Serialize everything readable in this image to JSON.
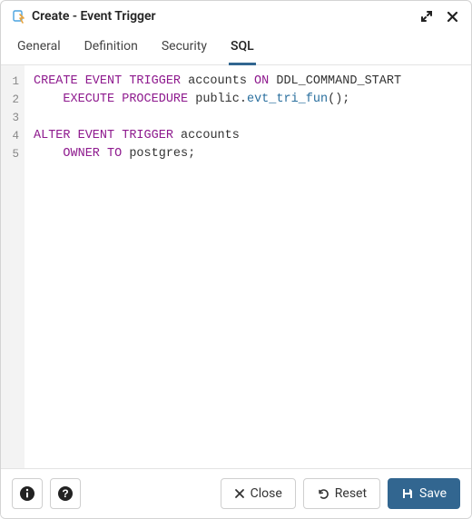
{
  "title": "Create - Event Trigger",
  "tabs": [
    {
      "label": "General"
    },
    {
      "label": "Definition"
    },
    {
      "label": "Security"
    },
    {
      "label": "SQL"
    }
  ],
  "active_tab_index": 3,
  "sql": {
    "lines": [
      [
        {
          "t": "CREATE EVENT TRIGGER",
          "c": "kw"
        },
        {
          "t": " accounts ",
          "c": "ident"
        },
        {
          "t": "ON",
          "c": "kw"
        },
        {
          "t": " DDL_COMMAND_START",
          "c": "ident"
        }
      ],
      [
        {
          "t": "    ",
          "c": "ident"
        },
        {
          "t": "EXECUTE PROCEDURE",
          "c": "kw"
        },
        {
          "t": " public",
          "c": "schema"
        },
        {
          "t": ".",
          "c": "ident"
        },
        {
          "t": "evt_tri_fun",
          "c": "fn"
        },
        {
          "t": "();",
          "c": "ident"
        }
      ],
      [],
      [
        {
          "t": "ALTER EVENT TRIGGER",
          "c": "kw"
        },
        {
          "t": " accounts",
          "c": "ident"
        }
      ],
      [
        {
          "t": "    ",
          "c": "ident"
        },
        {
          "t": "OWNER TO",
          "c": "kw"
        },
        {
          "t": " postgres;",
          "c": "ident"
        }
      ]
    ]
  },
  "footer": {
    "close_label": "Close",
    "reset_label": "Reset",
    "save_label": "Save"
  }
}
